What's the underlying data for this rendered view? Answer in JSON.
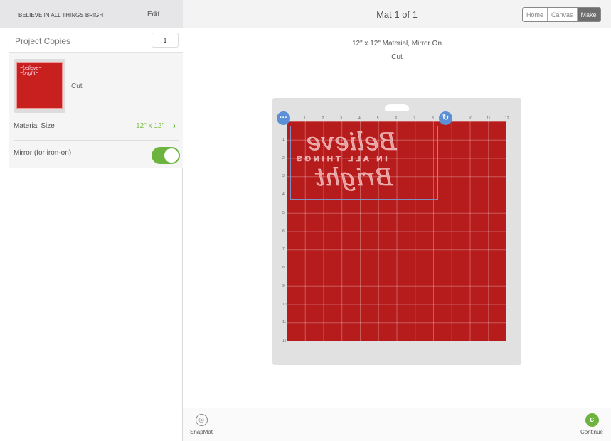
{
  "left_panel": {
    "project_title": "BELIEVE IN ALL THINGS BRIGHT",
    "edit_label": "Edit",
    "project_copies_label": "Project Copies",
    "project_copies_value": "1",
    "mat_operation": "Cut",
    "material_size_label": "Material Size",
    "material_size_value": "12\" x 12\"",
    "mirror_label": "Mirror (for iron-on)",
    "mirror_on": true
  },
  "header": {
    "mat_title": "Mat 1 of 1",
    "nav": [
      "Home",
      "Canvas",
      "Make"
    ],
    "active_nav": "Make"
  },
  "mat_info": {
    "line1": "12\" x 12\" Material, Mirror On",
    "line2": "Cut"
  },
  "mat": {
    "color": "#b71c1c",
    "ruler_max": 12,
    "design_text": [
      "Believe",
      "IN ALL THINGS",
      "Bright"
    ]
  },
  "footer": {
    "snapmat_label": "SnapMat",
    "continue_label": "Continue"
  },
  "colors": {
    "accent_green": "#6db33f",
    "handle_blue": "#5b8fd6"
  }
}
